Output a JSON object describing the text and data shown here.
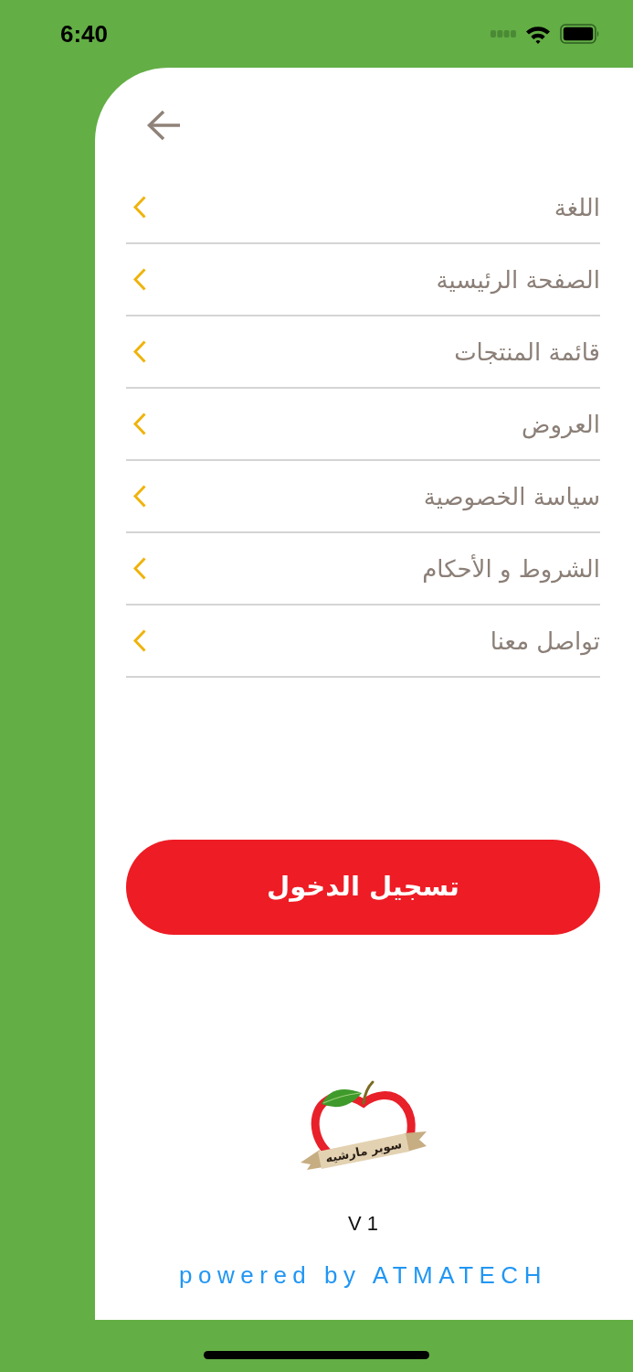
{
  "status_bar": {
    "time": "6:40"
  },
  "menu": {
    "items": [
      {
        "label": "اللغة"
      },
      {
        "label": "الصفحة الرئيسية"
      },
      {
        "label": "قائمة المنتجات"
      },
      {
        "label": "العروض"
      },
      {
        "label": "سياسة الخصوصية"
      },
      {
        "label": "الشروط و الأحكام"
      },
      {
        "label": "تواصل معنا"
      }
    ]
  },
  "login_button": {
    "label": "تسجيل الدخول"
  },
  "logo": {
    "text": "سوبر مارشيه"
  },
  "footer": {
    "version": "V 1",
    "powered_by": "powered by ATMATECH"
  }
}
